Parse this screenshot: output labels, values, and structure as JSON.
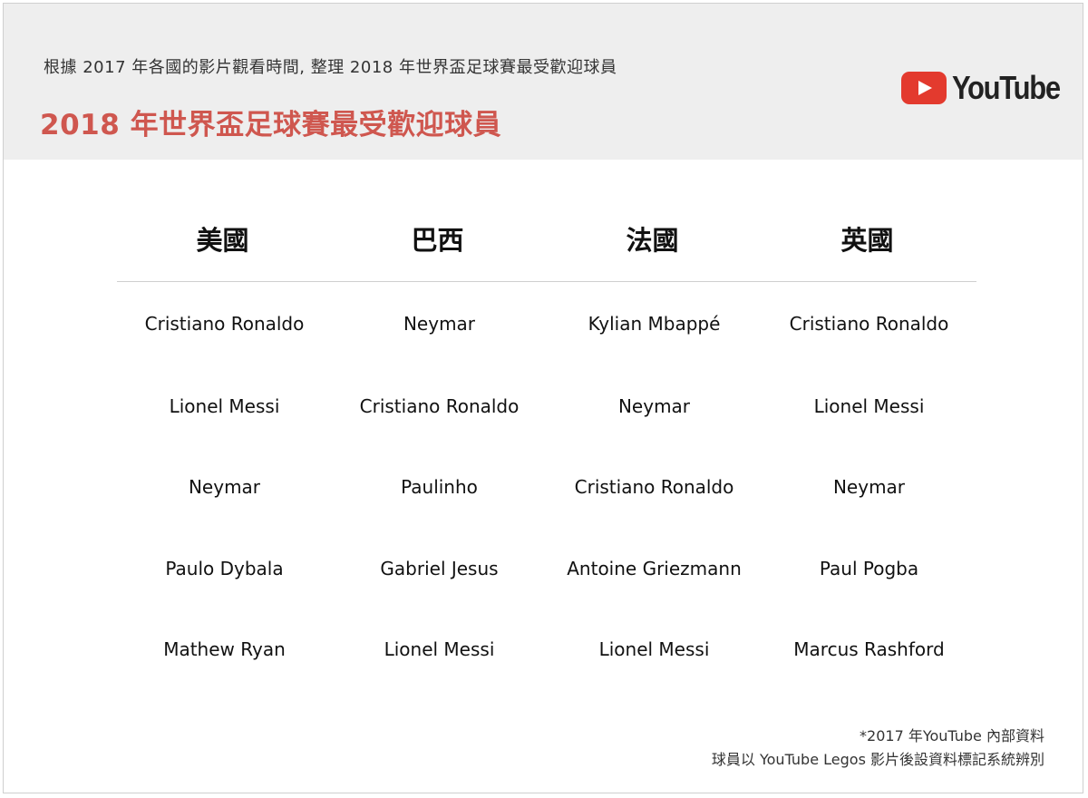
{
  "header": {
    "subtitle": "根據 2017 年各國的影片觀看時間, 整理 2018 年世界盃足球賽最受歡迎球員",
    "title": "2018 年世界盃足球賽最受歡迎球員",
    "logo_text": "YouTube",
    "logo_icon": "youtube-play-icon"
  },
  "table": {
    "columns": [
      "美國",
      "巴西",
      "法國",
      "英國"
    ],
    "rows": [
      [
        "Cristiano Ronaldo",
        "Neymar",
        "Kylian Mbappé",
        "Cristiano Ronaldo"
      ],
      [
        "Lionel Messi",
        "Cristiano Ronaldo",
        "Neymar",
        "Lionel Messi"
      ],
      [
        "Neymar",
        "Paulinho",
        "Cristiano Ronaldo",
        "Neymar"
      ],
      [
        "Paulo Dybala",
        "Gabriel Jesus",
        "Antoine Griezmann",
        "Paul Pogba"
      ],
      [
        "Mathew Ryan",
        "Lionel Messi",
        "Lionel Messi",
        "Marcus Rashford"
      ]
    ]
  },
  "footnote": {
    "line1": "*2017 年YouTube 內部資料",
    "line2": "球員以 YouTube Legos 影片後設資料標記系統辨別"
  },
  "colors": {
    "title": "#cf574f",
    "header_bg": "#eeeeee",
    "logo_red": "#e33a2e"
  }
}
